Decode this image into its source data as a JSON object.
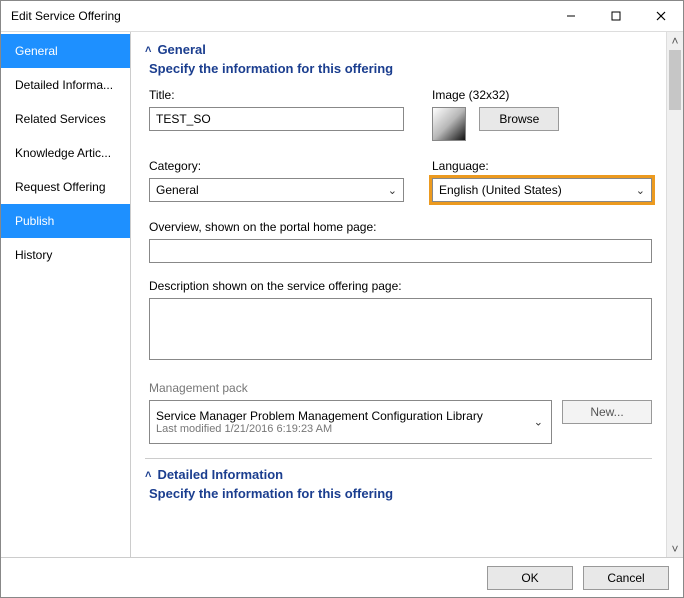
{
  "window": {
    "title": "Edit Service Offering"
  },
  "sidebar": {
    "items": [
      {
        "label": "General"
      },
      {
        "label": "Detailed Informa..."
      },
      {
        "label": "Related Services"
      },
      {
        "label": "Knowledge Artic..."
      },
      {
        "label": "Request Offering"
      },
      {
        "label": "Publish"
      },
      {
        "label": "History"
      }
    ]
  },
  "general": {
    "heading": "General",
    "subheading": "Specify the information for this offering",
    "title_label": "Title:",
    "title_value": "TEST_SO",
    "image_label": "Image (32x32)",
    "browse_label": "Browse",
    "category_label": "Category:",
    "category_value": "General",
    "language_label": "Language:",
    "language_value": "English (United States)",
    "overview_label": "Overview, shown on the portal home page:",
    "overview_value": "",
    "description_label": "Description shown on the service offering page:",
    "description_value": "",
    "mp_label": "Management pack",
    "mp_value": "Service Manager Problem Management Configuration Library",
    "mp_modified": "Last modified  1/21/2016 6:19:23 AM",
    "new_label": "New..."
  },
  "detailed": {
    "heading": "Detailed Information",
    "subheading": "Specify the information for this offering"
  },
  "footer": {
    "ok": "OK",
    "cancel": "Cancel"
  }
}
